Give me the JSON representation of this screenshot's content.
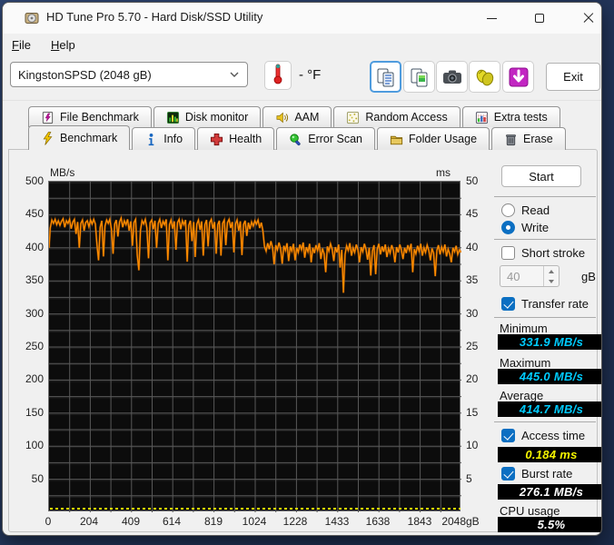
{
  "window": {
    "title": "HD Tune Pro 5.70 - Hard Disk/SSD Utility",
    "app_icon": "disk-icon",
    "controls": [
      "minimize",
      "maximize",
      "close"
    ]
  },
  "menu": {
    "items": [
      "File",
      "Help"
    ]
  },
  "toolbar": {
    "drive_selected": "KingstonSPSD (2048 gB)",
    "temperature_text": "- °F",
    "thermometer_icon": "thermometer-icon",
    "buttons": [
      {
        "icon": "copy-report-icon",
        "selected": true
      },
      {
        "icon": "copy-image-icon",
        "selected": false
      },
      {
        "icon": "camera-icon",
        "selected": false
      },
      {
        "icon": "hands-icon",
        "selected": false
      },
      {
        "icon": "download-icon",
        "selected": false
      }
    ],
    "exit_label": "Exit"
  },
  "tabs": {
    "row1": [
      {
        "label": "File Benchmark",
        "icon": "file-benchmark-icon",
        "active": false
      },
      {
        "label": "Disk monitor",
        "icon": "disk-monitor-icon",
        "active": false
      },
      {
        "label": "AAM",
        "icon": "speaker-icon",
        "active": false
      },
      {
        "label": "Random Access",
        "icon": "random-access-icon",
        "active": false
      },
      {
        "label": "Extra tests",
        "icon": "extra-tests-icon",
        "active": false
      }
    ],
    "row2": [
      {
        "label": "Benchmark",
        "icon": "benchmark-bolt-icon",
        "active": true
      },
      {
        "label": "Info",
        "icon": "info-icon",
        "active": false
      },
      {
        "label": "Health",
        "icon": "health-cross-icon",
        "active": false
      },
      {
        "label": "Error Scan",
        "icon": "error-scan-icon",
        "active": false
      },
      {
        "label": "Folder Usage",
        "icon": "folder-icon",
        "active": false
      },
      {
        "label": "Erase",
        "icon": "erase-trash-icon",
        "active": false
      }
    ]
  },
  "controls": {
    "start_label": "Start",
    "read_label": "Read",
    "read_selected": false,
    "write_label": "Write",
    "write_selected": true,
    "short_stroke_label": "Short stroke",
    "short_stroke_checked": false,
    "short_stroke_value": "40",
    "short_stroke_unit": "gB",
    "transfer_rate_label": "Transfer rate",
    "transfer_rate_checked": true,
    "access_time_label": "Access time",
    "access_time_checked": true,
    "burst_rate_label": "Burst rate",
    "burst_rate_checked": true
  },
  "stats": {
    "minimum_label": "Minimum",
    "minimum_value": "331.9 MB/s",
    "maximum_label": "Maximum",
    "maximum_value": "445.0 MB/s",
    "average_label": "Average",
    "average_value": "414.7 MB/s",
    "access_time_value": "0.184 ms",
    "burst_rate_value": "276.1 MB/s",
    "cpu_usage_label": "CPU usage",
    "cpu_usage_value": "5.5%"
  },
  "chart_data": {
    "type": "line",
    "title": "",
    "xlabel_unit": "gB",
    "left_axis": {
      "unit": "MB/s",
      "min": 0,
      "max": 500,
      "tick_step": 50,
      "minor_step": 25,
      "ticks": [
        "500",
        "450",
        "400",
        "350",
        "300",
        "250",
        "200",
        "150",
        "100",
        "50"
      ]
    },
    "right_axis": {
      "unit": "ms",
      "min": 0,
      "max": 50,
      "tick_step": 5,
      "ticks": [
        "50",
        "45",
        "40",
        "35",
        "30",
        "25",
        "20",
        "15",
        "10",
        "5"
      ]
    },
    "x_axis": {
      "min": 0,
      "max": 2048,
      "minor_step": 102.4,
      "tick_labels": [
        "0",
        "204",
        "409",
        "614",
        "819",
        "1024",
        "1228",
        "1433",
        "1638",
        "1843",
        "2048gB"
      ]
    },
    "grid": {
      "on": true,
      "color": "#585858"
    },
    "line_color": "#ff8c00",
    "access_dot_color": "#e8e800",
    "access_time_ms": 0.184,
    "series": [
      {
        "name": "transfer_rate_MB_s",
        "points": [
          [
            0,
            400
          ],
          [
            6,
            430
          ],
          [
            14,
            442
          ],
          [
            22,
            437
          ],
          [
            30,
            443
          ],
          [
            38,
            435
          ],
          [
            46,
            441
          ],
          [
            54,
            434
          ],
          [
            62,
            440
          ],
          [
            70,
            444
          ],
          [
            78,
            431
          ],
          [
            86,
            441
          ],
          [
            94,
            437
          ],
          [
            102,
            443
          ],
          [
            110,
            429
          ],
          [
            118,
            439
          ],
          [
            126,
            443
          ],
          [
            134,
            421
          ],
          [
            142,
            439
          ],
          [
            150,
            400
          ],
          [
            158,
            437
          ],
          [
            166,
            442
          ],
          [
            174,
            426
          ],
          [
            182,
            438
          ],
          [
            190,
            441
          ],
          [
            198,
            432
          ],
          [
            206,
            442
          ],
          [
            214,
            436
          ],
          [
            222,
            443
          ],
          [
            230,
            436
          ],
          [
            238,
            404
          ],
          [
            246,
            381
          ],
          [
            254,
            431
          ],
          [
            262,
            441
          ],
          [
            270,
            387
          ],
          [
            278,
            433
          ],
          [
            286,
            442
          ],
          [
            294,
            437
          ],
          [
            302,
            443
          ],
          [
            310,
            428
          ],
          [
            318,
            391
          ],
          [
            326,
            436
          ],
          [
            334,
            442
          ],
          [
            342,
            417
          ],
          [
            350,
            439
          ],
          [
            358,
            445
          ],
          [
            366,
            431
          ],
          [
            374,
            441
          ],
          [
            382,
            435
          ],
          [
            390,
            443
          ],
          [
            398,
            426
          ],
          [
            406,
            440
          ],
          [
            414,
            403
          ],
          [
            422,
            438
          ],
          [
            430,
            443
          ],
          [
            438,
            389
          ],
          [
            446,
            366
          ],
          [
            454,
            426
          ],
          [
            462,
            441
          ],
          [
            470,
            436
          ],
          [
            478,
            443
          ],
          [
            486,
            430
          ],
          [
            494,
            384
          ],
          [
            502,
            438
          ],
          [
            510,
            442
          ],
          [
            518,
            428
          ],
          [
            526,
            441
          ],
          [
            534,
            400
          ],
          [
            542,
            437
          ],
          [
            550,
            443
          ],
          [
            558,
            430
          ],
          [
            566,
            440
          ],
          [
            574,
            435
          ],
          [
            582,
            443
          ],
          [
            590,
            381
          ],
          [
            598,
            435
          ],
          [
            606,
            442
          ],
          [
            614,
            429
          ],
          [
            622,
            440
          ],
          [
            630,
            397
          ],
          [
            638,
            438
          ],
          [
            646,
            443
          ],
          [
            654,
            428
          ],
          [
            662,
            441
          ],
          [
            670,
            435
          ],
          [
            678,
            442
          ],
          [
            686,
            379
          ],
          [
            694,
            434
          ],
          [
            702,
            441
          ],
          [
            710,
            410
          ],
          [
            718,
            439
          ],
          [
            726,
            386
          ],
          [
            734,
            436
          ],
          [
            742,
            442
          ],
          [
            750,
            427
          ],
          [
            758,
            440
          ],
          [
            766,
            388
          ],
          [
            774,
            435
          ],
          [
            782,
            442
          ],
          [
            790,
            402
          ],
          [
            798,
            438
          ],
          [
            806,
            443
          ],
          [
            814,
            429
          ],
          [
            822,
            439
          ],
          [
            830,
            391
          ],
          [
            838,
            435
          ],
          [
            846,
            441
          ],
          [
            854,
            388
          ],
          [
            862,
            437
          ],
          [
            870,
            442
          ],
          [
            878,
            404
          ],
          [
            886,
            438
          ],
          [
            894,
            443
          ],
          [
            902,
            430
          ],
          [
            910,
            439
          ],
          [
            918,
            393
          ],
          [
            926,
            436
          ],
          [
            934,
            442
          ],
          [
            942,
            426
          ],
          [
            950,
            440
          ],
          [
            958,
            389
          ],
          [
            966,
            435
          ],
          [
            974,
            441
          ],
          [
            982,
            418
          ],
          [
            990,
            438
          ],
          [
            998,
            428
          ],
          [
            1006,
            439
          ],
          [
            1014,
            433
          ],
          [
            1022,
            441
          ],
          [
            1030,
            436
          ],
          [
            1038,
            442
          ],
          [
            1046,
            430
          ],
          [
            1054,
            438
          ],
          [
            1062,
            426
          ],
          [
            1070,
            402
          ],
          [
            1078,
            395
          ],
          [
            1086,
            407
          ],
          [
            1094,
            398
          ],
          [
            1102,
            410
          ],
          [
            1110,
            400
          ],
          [
            1118,
            375
          ],
          [
            1126,
            404
          ],
          [
            1134,
            397
          ],
          [
            1142,
            408
          ],
          [
            1150,
            399
          ],
          [
            1158,
            376
          ],
          [
            1166,
            403
          ],
          [
            1174,
            396
          ],
          [
            1182,
            407
          ],
          [
            1190,
            380
          ],
          [
            1198,
            402
          ],
          [
            1206,
            395
          ],
          [
            1214,
            406
          ],
          [
            1222,
            381
          ],
          [
            1230,
            400
          ],
          [
            1238,
            393
          ],
          [
            1246,
            405
          ],
          [
            1254,
            397
          ],
          [
            1262,
            408
          ],
          [
            1270,
            385
          ],
          [
            1278,
            401
          ],
          [
            1286,
            394
          ],
          [
            1294,
            406
          ],
          [
            1302,
            378
          ],
          [
            1310,
            400
          ],
          [
            1318,
            392
          ],
          [
            1326,
            404
          ],
          [
            1334,
            396
          ],
          [
            1342,
            407
          ],
          [
            1350,
            383
          ],
          [
            1358,
            399
          ],
          [
            1366,
            391
          ],
          [
            1374,
            363
          ],
          [
            1382,
            402
          ],
          [
            1390,
            395
          ],
          [
            1398,
            406
          ],
          [
            1406,
            398
          ],
          [
            1414,
            380
          ],
          [
            1422,
            401
          ],
          [
            1430,
            393
          ],
          [
            1438,
            405
          ],
          [
            1446,
            370
          ],
          [
            1454,
            397
          ],
          [
            1462,
            332
          ],
          [
            1470,
            390
          ],
          [
            1478,
            403
          ],
          [
            1486,
            396
          ],
          [
            1494,
            407
          ],
          [
            1502,
            388
          ],
          [
            1510,
            400
          ],
          [
            1518,
            393
          ],
          [
            1526,
            405
          ],
          [
            1534,
            397
          ],
          [
            1542,
            378
          ],
          [
            1550,
            401
          ],
          [
            1558,
            394
          ],
          [
            1566,
            406
          ],
          [
            1574,
            398
          ],
          [
            1582,
            382
          ],
          [
            1590,
            400
          ],
          [
            1598,
            358
          ],
          [
            1606,
            395
          ],
          [
            1614,
            404
          ],
          [
            1622,
            360
          ],
          [
            1630,
            398
          ],
          [
            1638,
            406
          ],
          [
            1646,
            390
          ],
          [
            1654,
            402
          ],
          [
            1662,
            394
          ],
          [
            1670,
            405
          ],
          [
            1678,
            386
          ],
          [
            1686,
            399
          ],
          [
            1694,
            392
          ],
          [
            1702,
            404
          ],
          [
            1710,
            396
          ],
          [
            1718,
            378
          ],
          [
            1726,
            401
          ],
          [
            1734,
            393
          ],
          [
            1742,
            405
          ],
          [
            1750,
            397
          ],
          [
            1758,
            383
          ],
          [
            1766,
            400
          ],
          [
            1774,
            392
          ],
          [
            1782,
            404
          ],
          [
            1790,
            396
          ],
          [
            1798,
            406
          ],
          [
            1806,
            363
          ],
          [
            1814,
            398
          ],
          [
            1822,
            391
          ],
          [
            1830,
            403
          ],
          [
            1838,
            395
          ],
          [
            1846,
            406
          ],
          [
            1854,
            388
          ],
          [
            1862,
            400
          ],
          [
            1870,
            393
          ],
          [
            1878,
            404
          ],
          [
            1886,
            396
          ],
          [
            1894,
            381
          ],
          [
            1902,
            399
          ],
          [
            1910,
            392
          ],
          [
            1918,
            357
          ],
          [
            1926,
            396
          ],
          [
            1934,
            404
          ],
          [
            1942,
            390
          ],
          [
            1950,
            401
          ],
          [
            1958,
            394
          ],
          [
            1966,
            405
          ],
          [
            1974,
            387
          ],
          [
            1982,
            398
          ],
          [
            1990,
            391
          ],
          [
            1998,
            378
          ],
          [
            2006,
            400
          ],
          [
            2014,
            394
          ],
          [
            2022,
            403
          ],
          [
            2030,
            390
          ],
          [
            2038,
            397
          ],
          [
            2046,
            393
          ]
        ]
      }
    ]
  }
}
